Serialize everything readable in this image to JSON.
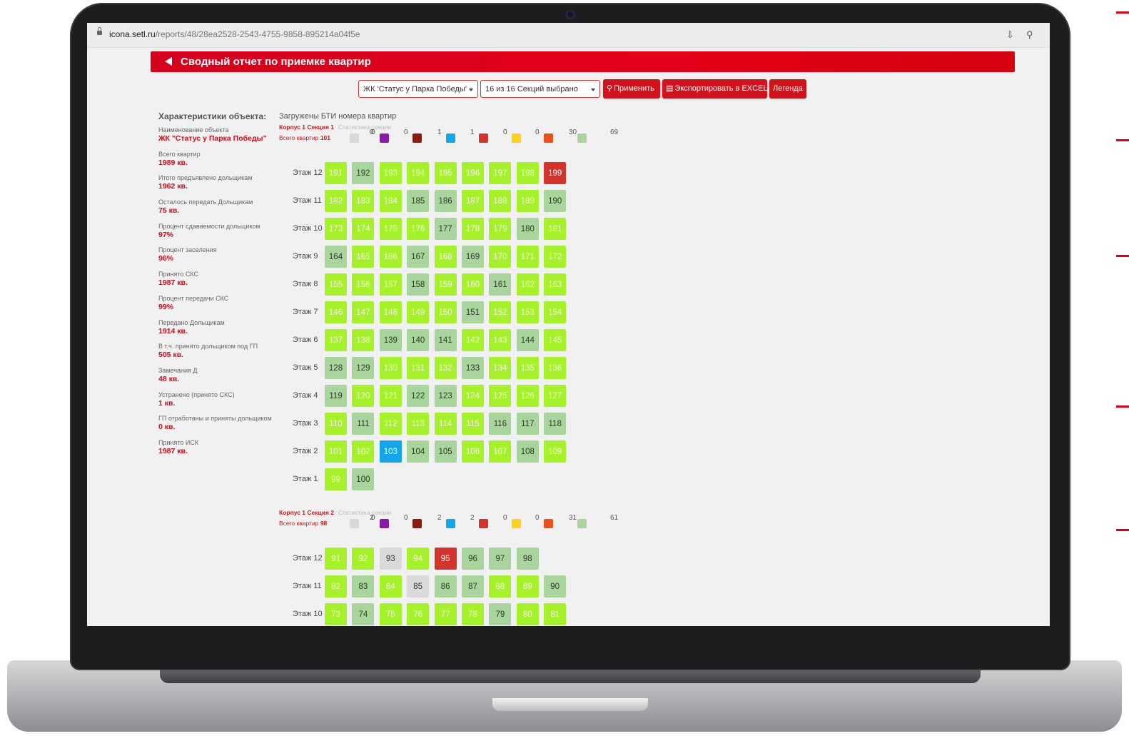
{
  "browser": {
    "url_host": "icona.setl.ru",
    "url_path": "/reports/48/28ea2528-2543-4755-9858-895214a04f5e"
  },
  "header": {
    "title": "Сводный отчет по приемке квартир"
  },
  "toolbar": {
    "object_select": "ЖК 'Статус у Парка Победы'",
    "sections_select": "16 из 16 Секций выбрано",
    "apply_label": "Применить",
    "export_label": "Экспортировать в EXCEL",
    "legend_label": "Легенда"
  },
  "characteristics": {
    "heading": "Характеристики объекта:",
    "items": [
      {
        "label": "Наименование объекта",
        "value": "ЖК \"Статус у Парка Победы\""
      },
      {
        "label": "Всего квартир",
        "value": "1989 кв."
      },
      {
        "label": "Итого предъявлено дольщикам",
        "value": "1962 кв."
      },
      {
        "label": "Осталось передать Дольщикам",
        "value": "75 кв."
      },
      {
        "label": "Процент сдаваемости дольщиком",
        "value": "97%"
      },
      {
        "label": "Процент заселения",
        "value": "96%"
      },
      {
        "label": "Принято СКС",
        "value": "1987 кв."
      },
      {
        "label": "Процент передачи СКС",
        "value": "99%"
      },
      {
        "label": "Передано Дольщикам",
        "value": "1914 кв."
      },
      {
        "label": "В т.ч. принято дольщиком под ГП",
        "value": "505 кв."
      },
      {
        "label": "Замечания Д",
        "value": "48 кв."
      },
      {
        "label": "Устранено (принято СКС)",
        "value": "1 кв."
      },
      {
        "label": "ГП отработаны и приняты дольщиком",
        "value": "0 кв."
      },
      {
        "label": "Принято ИСК",
        "value": "1987 кв."
      }
    ]
  },
  "loaded_note": "Загружены БТИ номера квартир",
  "legend_colors": [
    "#d9d9d9",
    "#8a1aa6",
    "#8b1a10",
    "#14a5ea",
    "#d2342c",
    "#ffd21a",
    "#e8501c",
    "#a8d59b",
    "#a6f22a"
  ],
  "sections": [
    {
      "name": "Корпус 1 Секция 1",
      "stats_link": "Статистика секции",
      "total_label": "Всего квартир",
      "total_value": "101",
      "legend_counts": [
        "0",
        "0",
        "0",
        "1",
        "1",
        "0",
        "0",
        "30",
        "69"
      ],
      "floors": [
        {
          "label": "Этаж 12",
          "apts": [
            [
              "191",
              "green"
            ],
            [
              "192",
              "grey"
            ],
            [
              "193",
              "green"
            ],
            [
              "194",
              "green"
            ],
            [
              "195",
              "green"
            ],
            [
              "196",
              "green"
            ],
            [
              "197",
              "green"
            ],
            [
              "198",
              "green"
            ],
            [
              "199",
              "red"
            ]
          ]
        },
        {
          "label": "Этаж 11",
          "apts": [
            [
              "182",
              "green"
            ],
            [
              "183",
              "green"
            ],
            [
              "184",
              "green"
            ],
            [
              "185",
              "grey"
            ],
            [
              "186",
              "grey"
            ],
            [
              "187",
              "green"
            ],
            [
              "188",
              "green"
            ],
            [
              "189",
              "green"
            ],
            [
              "190",
              "grey"
            ]
          ]
        },
        {
          "label": "Этаж 10",
          "apts": [
            [
              "173",
              "green"
            ],
            [
              "174",
              "green"
            ],
            [
              "175",
              "green"
            ],
            [
              "176",
              "green"
            ],
            [
              "177",
              "grey"
            ],
            [
              "178",
              "green"
            ],
            [
              "179",
              "green"
            ],
            [
              "180",
              "grey"
            ],
            [
              "181",
              "green"
            ]
          ]
        },
        {
          "label": "Этаж 9",
          "apts": [
            [
              "164",
              "grey"
            ],
            [
              "165",
              "green"
            ],
            [
              "166",
              "green"
            ],
            [
              "167",
              "grey"
            ],
            [
              "168",
              "green"
            ],
            [
              "169",
              "grey"
            ],
            [
              "170",
              "green"
            ],
            [
              "171",
              "green"
            ],
            [
              "172",
              "green"
            ]
          ]
        },
        {
          "label": "Этаж 8",
          "apts": [
            [
              "155",
              "green"
            ],
            [
              "156",
              "green"
            ],
            [
              "157",
              "green"
            ],
            [
              "158",
              "grey"
            ],
            [
              "159",
              "green"
            ],
            [
              "160",
              "green"
            ],
            [
              "161",
              "grey"
            ],
            [
              "162",
              "green"
            ],
            [
              "163",
              "green"
            ]
          ]
        },
        {
          "label": "Этаж 7",
          "apts": [
            [
              "146",
              "green"
            ],
            [
              "147",
              "green"
            ],
            [
              "148",
              "green"
            ],
            [
              "149",
              "green"
            ],
            [
              "150",
              "green"
            ],
            [
              "151",
              "grey"
            ],
            [
              "152",
              "green"
            ],
            [
              "153",
              "green"
            ],
            [
              "154",
              "green"
            ]
          ]
        },
        {
          "label": "Этаж 6",
          "apts": [
            [
              "137",
              "green"
            ],
            [
              "138",
              "green"
            ],
            [
              "139",
              "grey"
            ],
            [
              "140",
              "grey"
            ],
            [
              "141",
              "grey"
            ],
            [
              "142",
              "green"
            ],
            [
              "143",
              "green"
            ],
            [
              "144",
              "grey"
            ],
            [
              "145",
              "green"
            ]
          ]
        },
        {
          "label": "Этаж 5",
          "apts": [
            [
              "128",
              "grey"
            ],
            [
              "129",
              "grey"
            ],
            [
              "130",
              "green"
            ],
            [
              "131",
              "green"
            ],
            [
              "132",
              "green"
            ],
            [
              "133",
              "grey"
            ],
            [
              "134",
              "green"
            ],
            [
              "135",
              "green"
            ],
            [
              "136",
              "green"
            ]
          ]
        },
        {
          "label": "Этаж 4",
          "apts": [
            [
              "119",
              "grey"
            ],
            [
              "120",
              "green"
            ],
            [
              "121",
              "green"
            ],
            [
              "122",
              "grey"
            ],
            [
              "123",
              "grey"
            ],
            [
              "124",
              "green"
            ],
            [
              "125",
              "green"
            ],
            [
              "126",
              "green"
            ],
            [
              "127",
              "green"
            ]
          ]
        },
        {
          "label": "Этаж 3",
          "apts": [
            [
              "110",
              "green"
            ],
            [
              "111",
              "grey"
            ],
            [
              "112",
              "green"
            ],
            [
              "113",
              "green"
            ],
            [
              "114",
              "green"
            ],
            [
              "115",
              "green"
            ],
            [
              "116",
              "grey"
            ],
            [
              "117",
              "grey"
            ],
            [
              "118",
              "grey"
            ]
          ]
        },
        {
          "label": "Этаж 2",
          "apts": [
            [
              "101",
              "green"
            ],
            [
              "102",
              "green"
            ],
            [
              "103",
              "blue"
            ],
            [
              "104",
              "grey"
            ],
            [
              "105",
              "grey"
            ],
            [
              "106",
              "green"
            ],
            [
              "107",
              "green"
            ],
            [
              "108",
              "grey"
            ],
            [
              "109",
              "green"
            ]
          ]
        },
        {
          "label": "Этаж 1",
          "apts": [
            [
              "99",
              "green"
            ],
            [
              "100",
              "grey"
            ]
          ]
        }
      ]
    },
    {
      "name": "Корпус 1 Секция 2",
      "stats_link": "Статистика секции",
      "total_label": "Всего квартир",
      "total_value": "98",
      "legend_counts": [
        "2",
        "0",
        "0",
        "2",
        "2",
        "0",
        "0",
        "31",
        "61"
      ],
      "floors": [
        {
          "label": "Этаж 12",
          "apts": [
            [
              "91",
              "green"
            ],
            [
              "92",
              "green"
            ],
            [
              "93",
              "lgrey"
            ],
            [
              "94",
              "green"
            ],
            [
              "95",
              "red"
            ],
            [
              "96",
              "grey"
            ],
            [
              "97",
              "grey"
            ],
            [
              "98",
              "grey"
            ]
          ]
        },
        {
          "label": "Этаж 11",
          "apts": [
            [
              "82",
              "green"
            ],
            [
              "83",
              "grey"
            ],
            [
              "84",
              "green"
            ],
            [
              "85",
              "lgrey"
            ],
            [
              "86",
              "grey"
            ],
            [
              "87",
              "grey"
            ],
            [
              "88",
              "green"
            ],
            [
              "89",
              "green"
            ],
            [
              "90",
              "grey"
            ]
          ]
        },
        {
          "label": "Этаж 10",
          "apts": [
            [
              "73",
              "green"
            ],
            [
              "74",
              "grey"
            ],
            [
              "75",
              "green"
            ],
            [
              "76",
              "green"
            ],
            [
              "77",
              "green"
            ],
            [
              "78",
              "green"
            ],
            [
              "79",
              "grey"
            ],
            [
              "80",
              "green"
            ],
            [
              "81",
              "green"
            ]
          ]
        }
      ]
    }
  ]
}
